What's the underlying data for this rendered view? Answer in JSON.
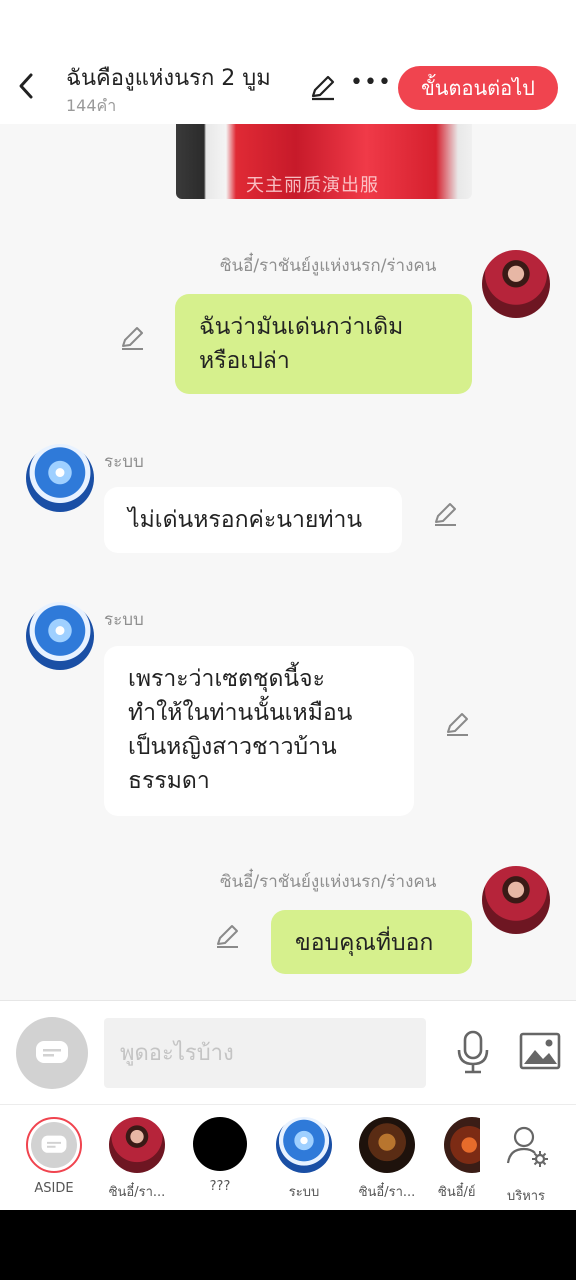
{
  "header": {
    "title": "ฉันคืองูแห่งนรก 2 บูม",
    "word_count": "144คำ",
    "next_label": "ขั้นตอนต่อไป"
  },
  "chat": {
    "top_image_caption": "天主丽质演出服",
    "messages": [
      {
        "side": "right",
        "speaker": "ซินอี๋/ราชันย์งูแห่งนรก/ร่างคน",
        "text_lines": [
          "ฉันว่ามันเด่นกว่าเดิม",
          "หรือเปล่า"
        ],
        "avatar": "woman-red-avatar"
      },
      {
        "side": "left",
        "speaker": "ระบบ",
        "text_lines": [
          "ไม่เด่นหรอกค่ะนายท่าน"
        ],
        "avatar": "system-blue-avatar"
      },
      {
        "side": "left",
        "speaker": "ระบบ",
        "text_lines": [
          "เพราะว่าเซตชุดนี้จะ",
          "ทำให้ในท่านนั้นเหมือน",
          "เป็นหญิงสาวชาวบ้าน",
          "ธรรมดา"
        ],
        "avatar": "system-blue-avatar"
      },
      {
        "side": "right",
        "speaker": "ซินอี๋/ราชันย์งูแห่งนรก/ร่างคน",
        "text_lines": [
          "ขอบคุณที่บอก"
        ],
        "avatar": "woman-red-avatar"
      }
    ]
  },
  "input": {
    "placeholder": "พูดอะไรบ้าง"
  },
  "characters": [
    {
      "label": "ASIDE",
      "kind": "aside"
    },
    {
      "label": "ซินอี๋/รา...",
      "kind": "red"
    },
    {
      "label": "???",
      "kind": "black"
    },
    {
      "label": "ระบบ",
      "kind": "blue"
    },
    {
      "label": "ซินอี๋/รา...",
      "kind": "snake"
    },
    {
      "label": "ซินอี๋/ย์",
      "kind": "dragon"
    },
    {
      "label": "บริหาร",
      "kind": "manage"
    }
  ],
  "colors": {
    "accent": "#f0444f",
    "user_bubble": "#d6f08d",
    "system_bubble": "#ffffff",
    "background": "#f7f7f7"
  }
}
